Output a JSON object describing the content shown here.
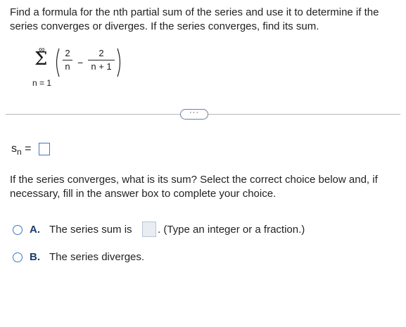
{
  "question": {
    "text": "Find a formula for the nth partial sum of the series and use it to determine if the series converges or diverges. If the series converges, find its sum."
  },
  "series": {
    "upper": "∞",
    "sigma": "Σ",
    "lower": "n = 1",
    "term1_num": "2",
    "term1_den": "n",
    "operator": "−",
    "term2_num": "2",
    "term2_den": "n + 1"
  },
  "more_button": {
    "label": "···"
  },
  "partial_sum": {
    "label_s": "s",
    "label_n": "n",
    "equals": "="
  },
  "prompt": {
    "text": "If the series converges, what is its sum? Select the correct choice below and, if necessary, fill in the answer box to complete your choice."
  },
  "choices": [
    {
      "letter": "A.",
      "text_before": "The series sum is",
      "text_after": ". (Type an integer or a fraction.)"
    },
    {
      "letter": "B.",
      "text": "The series diverges."
    }
  ],
  "colors": {
    "accent": "#3f77c7",
    "letter": "#1b3a6b",
    "divider": "#b5b5b5"
  }
}
